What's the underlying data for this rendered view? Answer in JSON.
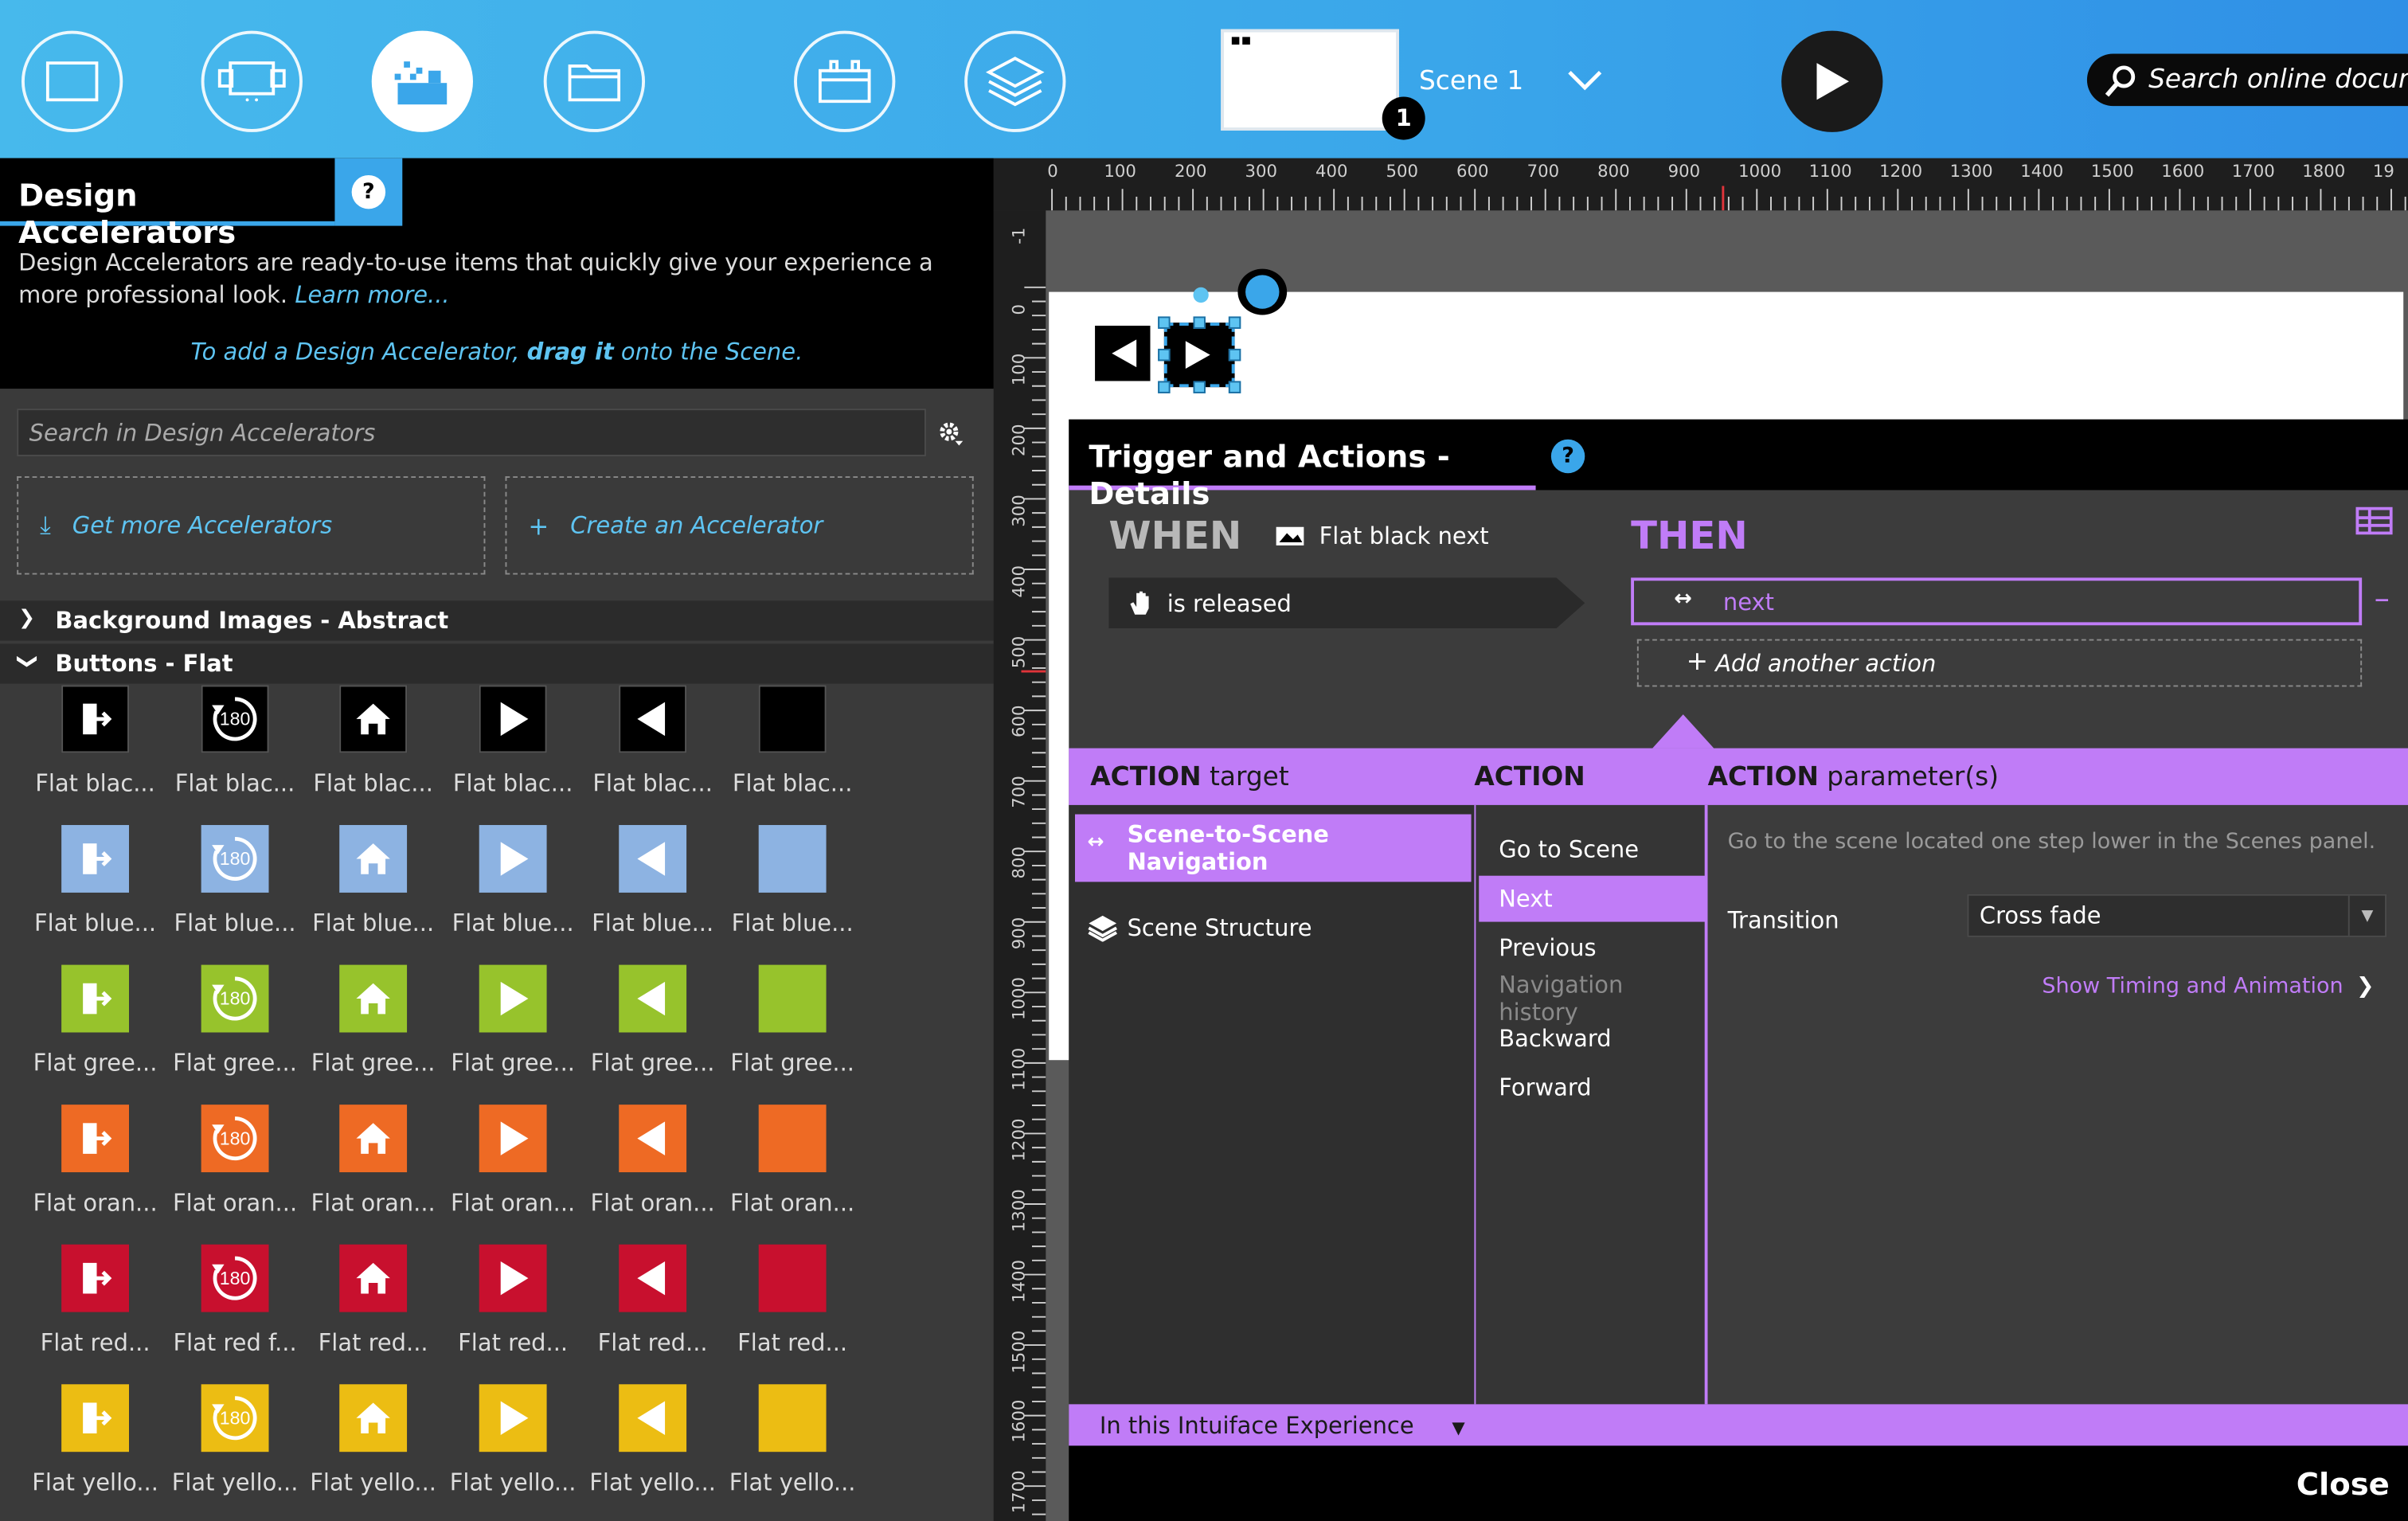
{
  "toolbar": {
    "scene_label": "Scene 1",
    "scene_badge": "1",
    "search_online": "Search online documentation"
  },
  "accelerators": {
    "title": "Design Accelerators",
    "help": "?",
    "description": "Design Accelerators are ready-to-use items that quickly give your experience a more professional look.",
    "learn_more": "Learn more...",
    "hint_pre": "To add a Design Accelerator,",
    "hint_bold": "drag it",
    "hint_post": "onto the Scene.",
    "search_placeholder": "Search in Design Accelerators",
    "get_more": "Get more Accelerators",
    "create": "Create an Accelerator",
    "category_bg": "Background Images - Abstract",
    "category_buttons": "Buttons - Flat",
    "rows": [
      {
        "color": "#000000",
        "labels": [
          "Flat blac...",
          "Flat blac...",
          "Flat blac...",
          "Flat blac...",
          "Flat blac...",
          "Flat blac..."
        ]
      },
      {
        "color": "#8db3e2",
        "labels": [
          "Flat blue...",
          "Flat blue...",
          "Flat blue...",
          "Flat blue...",
          "Flat blue...",
          "Flat blue..."
        ]
      },
      {
        "color": "#97c32c",
        "labels": [
          "Flat gree...",
          "Flat gree...",
          "Flat gree...",
          "Flat gree...",
          "Flat gree...",
          "Flat gree..."
        ]
      },
      {
        "color": "#ee6a24",
        "labels": [
          "Flat oran...",
          "Flat oran...",
          "Flat oran...",
          "Flat oran...",
          "Flat oran...",
          "Flat oran..."
        ]
      },
      {
        "color": "#c8102e",
        "labels": [
          "Flat red...",
          "Flat red f...",
          "Flat red...",
          "Flat red...",
          "Flat red...",
          "Flat red..."
        ]
      },
      {
        "color": "#ecbd13",
        "labels": [
          "Flat yello...",
          "Flat yello...",
          "Flat yello...",
          "Flat yello...",
          "Flat yello...",
          "Flat yello..."
        ]
      }
    ],
    "icons": [
      "exit-icon",
      "rotate-180-icon",
      "home-icon",
      "play-icon",
      "back-icon",
      "blank-square-icon"
    ],
    "rotate_text": "180"
  },
  "ruler": {
    "h_ticks": [
      "0",
      "100",
      "200",
      "300",
      "400",
      "500",
      "600",
      "700",
      "800",
      "900",
      "1000",
      "1100",
      "1200",
      "1300",
      "1400",
      "1500",
      "1600",
      "1700",
      "1800",
      "19"
    ],
    "v_ticks": [
      "-1",
      "0",
      "100",
      "200",
      "300",
      "400",
      "500",
      "600",
      "700",
      "800",
      "900",
      "1000",
      "1100",
      "1200",
      "1300",
      "1400",
      "1500",
      "1600",
      "1700"
    ]
  },
  "trigger": {
    "title": "Trigger and Actions - Details",
    "help": "?",
    "when": "WHEN",
    "when_object": "Flat black next",
    "then": "THEN",
    "trigger_event": "is released",
    "action_name": "next",
    "add_action": "Add another action",
    "minus": "–",
    "header_target_bold": "ACTION",
    "header_target": "target",
    "header_action": "ACTION",
    "header_params_bold": "ACTION",
    "header_params": "parameter(s)",
    "targets": [
      "Scene-to-Scene Navigation",
      "Scene Structure"
    ],
    "actions": [
      {
        "label": "Go to Scene",
        "type": "item"
      },
      {
        "label": "Next",
        "type": "selected"
      },
      {
        "label": "Previous",
        "type": "item"
      },
      {
        "label": "Navigation history",
        "type": "header"
      },
      {
        "label": "Backward",
        "type": "item"
      },
      {
        "label": "Forward",
        "type": "item"
      }
    ],
    "param_description": "Go to the scene located one step lower in the Scenes panel.",
    "transition_label": "Transition",
    "transition_value": "Cross fade",
    "timing_link": "Show Timing and Animation",
    "experience": "In this Intuiface Experience",
    "close": "Close"
  },
  "colors": {
    "accent_blue": "#3aa6ea",
    "accent_purple": "#c07cf7"
  }
}
